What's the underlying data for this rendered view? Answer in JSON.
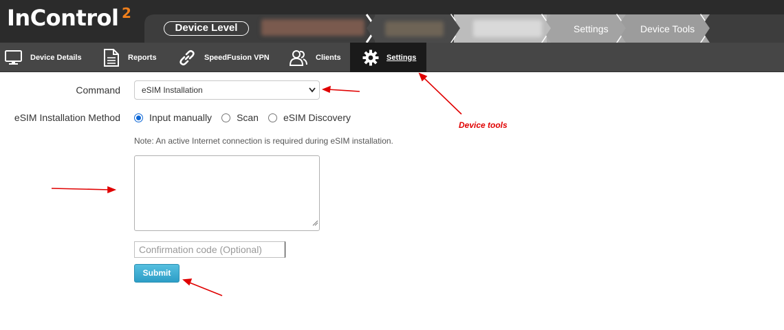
{
  "app": {
    "logo_text": "InControl",
    "logo_superscript": "2"
  },
  "breadcrumb": {
    "device_level_label": "Device Level",
    "items": [
      {
        "label": "Settings"
      },
      {
        "label": "Device Tools"
      }
    ]
  },
  "nav": {
    "items": [
      {
        "label": "Device Details",
        "icon": "monitor-icon"
      },
      {
        "label": "Reports",
        "icon": "document-icon"
      },
      {
        "label": "SpeedFusion VPN",
        "icon": "link-icon"
      },
      {
        "label": "Clients",
        "icon": "users-icon"
      },
      {
        "label": "Settings",
        "icon": "gear-icon",
        "active": true
      }
    ]
  },
  "form": {
    "command_label": "Command",
    "command_value": "eSIM Installation",
    "method_label": "eSIM Installation Method",
    "method_options": [
      {
        "label": "Input manually",
        "checked": true
      },
      {
        "label": "Scan",
        "checked": false
      },
      {
        "label": "eSIM Discovery",
        "checked": false
      }
    ],
    "note": "Note: An active Internet connection is required during eSIM installation.",
    "textarea_value": "",
    "confirmation_placeholder": "Confirmation code (Optional)",
    "submit_label": "Submit"
  },
  "annotation": {
    "text": "Device tools"
  },
  "colors": {
    "header_bg": "#2b2b2b",
    "nav_bg": "#464646",
    "nav_active_bg": "#1a1a1a",
    "logo_accent": "#f07f1b",
    "submit_bg": "#36a5cd",
    "radio_checked": "#0b66d6",
    "annotation_red": "#e00000"
  }
}
